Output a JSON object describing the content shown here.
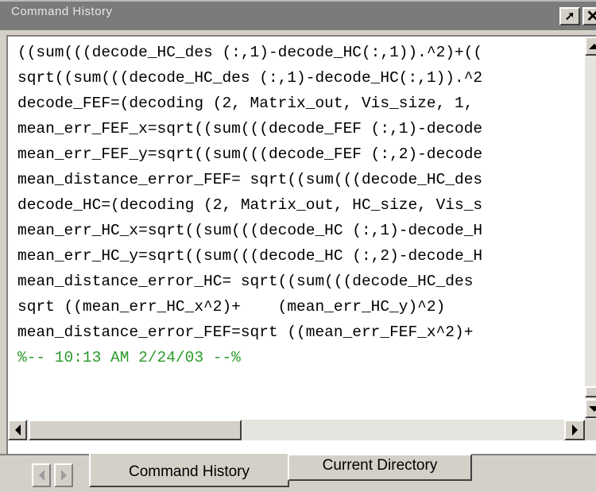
{
  "window": {
    "title": "Command History"
  },
  "history": {
    "lines": [
      "((sum(((decode_HC_des (:,1)-decode_HC(:,1)).^2)+((",
      "sqrt((sum(((decode_HC_des (:,1)-decode_HC(:,1)).^2",
      "decode_FEF=(decoding (2, Matrix_out, Vis_size, 1,",
      "mean_err_FEF_x=sqrt((sum(((decode_FEF (:,1)-decode",
      "mean_err_FEF_y=sqrt((sum(((decode_FEF (:,2)-decode",
      "mean_distance_error_FEF= sqrt((sum(((decode_HC_des",
      "decode_HC=(decoding (2, Matrix_out, HC_size, Vis_s",
      "mean_err_HC_x=sqrt((sum(((decode_HC (:,1)-decode_H",
      "mean_err_HC_y=sqrt((sum(((decode_HC (:,2)-decode_H",
      "mean_distance_error_HC= sqrt((sum(((decode_HC_des",
      "sqrt ((mean_err_HC_x^2)+    (mean_err_HC_y)^2)",
      "mean_distance_error_FEF=sqrt ((mean_err_FEF_x^2)+",
      "%-- 10:13 AM 2/24/03 --%"
    ],
    "stamp_color": "#2a9a2a"
  },
  "tabs": {
    "command_history": "Command History",
    "current_directory": "Current Directory"
  },
  "icons": {
    "undock": "undock-arrow-icon",
    "close": "close-icon"
  }
}
